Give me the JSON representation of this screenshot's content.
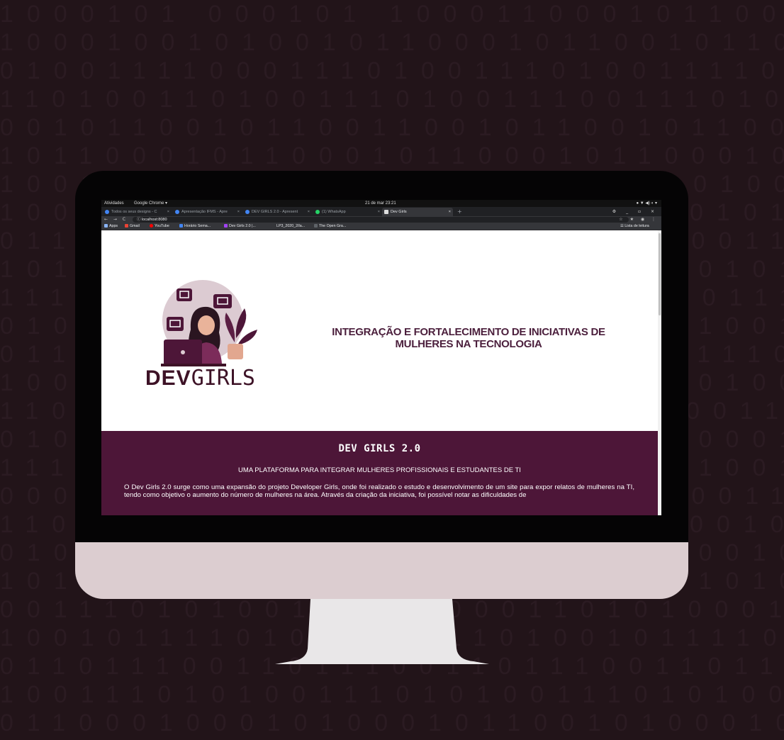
{
  "background": {
    "color": "#221419",
    "binary_rows": [
      "1000101 000101 1000110001011001011000101",
      "1000100101001011000101100101100010110001011",
      "0100111100011101001110100111100111100111",
      "1101001101001110100111001110100111001110",
      "0010110010110011001011001011001011010110",
      "1011000101100010110001011000101100010110",
      "1001001101001101001001101001001101001110",
      "1001011011001011001011011001011001011010",
      "0110100011010001101001101000110100110100",
      "1010100101010010101010101001010100101010",
      "1110011110011110011100111100111100111100",
      "0100101001010010100101001010010100101001",
      "0111101111011110111101111011110111101111",
      "1001001001001001001001001001001001001001",
      "1100110011001100110011001100110011001100",
      "0101000101001010001010010100010100101000",
      "1111001111001111001111001111001111001111",
      "0000110000110000110000110000110000110000",
      "1100101100101100101100101100101100101100",
      "0100100100100100100100100100100100100100",
      "1010101010101010101010101010101010101010",
      "0011101010011101100011010100011101010011",
      "1001011110100101111010010111101001011110",
      "0110111001101110011011100110111001101110",
      "1001110101001110101001110101001110101001",
      "0110001000101000101100101000101100100010",
      "1010011100100110101001101001001101001001"
    ]
  },
  "os_bar": {
    "activities": "Atividades",
    "app": "Google Chrome ▾",
    "clock": "21 de mar 23:21",
    "tray": "● ▼ ◀) ◐ ▾"
  },
  "browser": {
    "tabs": [
      {
        "label": "Todos os seus designs - C",
        "color": "#4285f4"
      },
      {
        "label": "Apresentação IFMS - Apre",
        "color": "#4285f4"
      },
      {
        "label": "DEV GIRLS 2.0 - Apresent",
        "color": "#4285f4"
      },
      {
        "label": "(1) WhatsApp",
        "color": "#25d366"
      },
      {
        "label": "Dev Girls",
        "color": "#ffffff"
      }
    ],
    "close_glyph": "×",
    "new_tab": "+",
    "window_controls": "⚙ _ ▫ ×",
    "nav_buttons": "← → C",
    "url": "ⓘ localhost:8080",
    "nav_right": "☆ ★ ◉ ⋮",
    "bookmarks": [
      {
        "label": "Apps",
        "color": "#8ab4f8"
      },
      {
        "label": "Gmail",
        "color": "#ea4335"
      },
      {
        "label": "YouTube",
        "color": "#ff0000"
      },
      {
        "label": "Horário Sema...",
        "color": "#4285f4"
      },
      {
        "label": "Dev Girls 2.0 |...",
        "color": "#a142f4"
      },
      {
        "label": "LP3_2020_2/la...",
        "color": "#35363a"
      },
      {
        "label": "The Open Gra...",
        "color": "#5f6368"
      }
    ],
    "reading_list": "☰ Lista de leitura"
  },
  "page": {
    "hero_title": "INTEGRAÇÃO E FORTALECIMENTO DE INICIATIVAS DE MULHERES NA TECNOLOGIA",
    "logo": {
      "dev": "DEV",
      "girls": "GIRLS"
    },
    "section": {
      "title": "DEV GIRLS 2.0",
      "subtitle": "UMA PLATAFORMA PARA INTEGRAR MULHERES PROFISSIONAIS E ESTUDANTES DE TI",
      "body": "O Dev Girls 2.0 surge como uma expansão do projeto Developer Girls, onde foi realizado o estudo e desenvolvimento de um site para expor relatos de mulheres na TI, tendo como objetivo o aumento do número de mulheres na área. Através da criação da iniciativa, foi possível notar as dificuldades de"
    },
    "colors": {
      "brand": "#4d1638",
      "title": "#4b1f3c"
    }
  }
}
